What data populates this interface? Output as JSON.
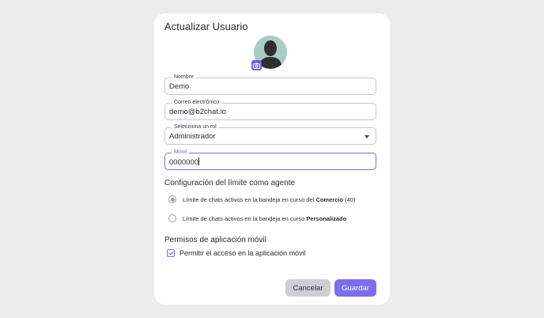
{
  "dialog": {
    "title": "Actualizar Usuario"
  },
  "form": {
    "name": {
      "label": "Nombre",
      "value": "Demo"
    },
    "email": {
      "label": "Correo electrónico",
      "value": "demo@b2chat.io"
    },
    "role": {
      "label": "Selecciona un rol",
      "value": "Administrador"
    },
    "mobile": {
      "label": "Móvil",
      "value": "0000000"
    }
  },
  "limits": {
    "heading": "Configuración del límite como agente",
    "option1": {
      "text": "Límite de chats activos en la bandeja en curso del ",
      "bold": "Comercio",
      "suffix": " (40)",
      "selected": true
    },
    "option2": {
      "text": "Límite de chats activos en la bandeja en curso ",
      "bold": "Personalizado",
      "selected": false
    }
  },
  "permissions": {
    "heading": "Permisos de aplicación móvil",
    "checkbox_label": "Permitir el acceso en la aplicación móvil",
    "checked": true
  },
  "actions": {
    "cancel_label": "Cancelar",
    "save_label": "Guardar"
  },
  "colors": {
    "accent": "#7c6cf0",
    "avatar_bg": "#a9cdc5"
  }
}
